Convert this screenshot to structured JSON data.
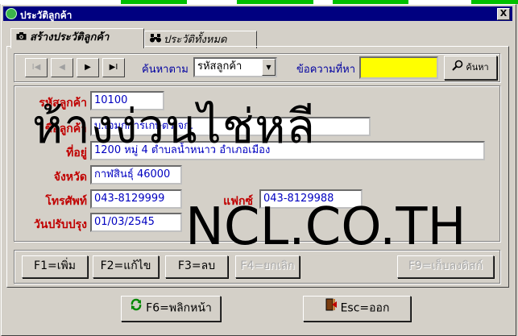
{
  "window": {
    "title": "ประวัติลูกค้า",
    "close_label": "X"
  },
  "tabs": [
    {
      "label": "สร้างประวัติลูกค้า",
      "icon": "camera-icon",
      "active": true
    },
    {
      "label": "ประวัติทั้งหมด",
      "icon": "binoculars-icon",
      "active": false
    }
  ],
  "nav": {
    "buttons": [
      {
        "name": "first",
        "glyph": "I◀",
        "disabled": true
      },
      {
        "name": "prev",
        "glyph": "◀",
        "disabled": true
      },
      {
        "name": "next",
        "glyph": "▶",
        "disabled": false
      },
      {
        "name": "last",
        "glyph": "▶I",
        "disabled": false
      }
    ],
    "search_by_label": "ค้นหาตาม",
    "search_by_value": "รหัสลูกค้า",
    "search_text_label": "ข้อความที่หา",
    "search_text_value": "",
    "search_button": "ค้นหา"
  },
  "form": {
    "customer_code_label": "รหัสลูกค้า",
    "customer_code": "10100",
    "customer_name_label": "ชื่อลูกค้า",
    "customer_name": "บ.เจมุกการเกษตร จก.",
    "address_label": "ที่อยู่",
    "address": "1200 หมู่ 4 ตำบลน้ำหนาว อำเภอเมือง",
    "province_label": "จังหวัด",
    "province": "กาฬสินธุ์ 46000",
    "phone_label": "โทรศัพท์",
    "phone": "043-8129999",
    "fax_label": "แฟกซ์",
    "fax": "043-8129988",
    "updated_label": "วันปรับปรุง",
    "updated": "01/03/2545"
  },
  "actions": {
    "add": "F1=เพิ่ม",
    "edit": "F2=แก้ไข",
    "delete": "F3=ลบ",
    "cancel": "F4=ยกเลิก",
    "save": "F9=เก็บลงดิสก์",
    "refresh": "F6=พลิกหน้า",
    "exit": "Esc=ออก"
  },
  "watermark": {
    "thai": "ห้างง่วนไช่หลี",
    "domain": "NCL.CO.TH"
  },
  "colors": {
    "title_bar": "#000080",
    "label_red": "#c00000",
    "label_blue": "#0000a0",
    "field_text": "#0000c0",
    "search_field": "#ffff00"
  }
}
